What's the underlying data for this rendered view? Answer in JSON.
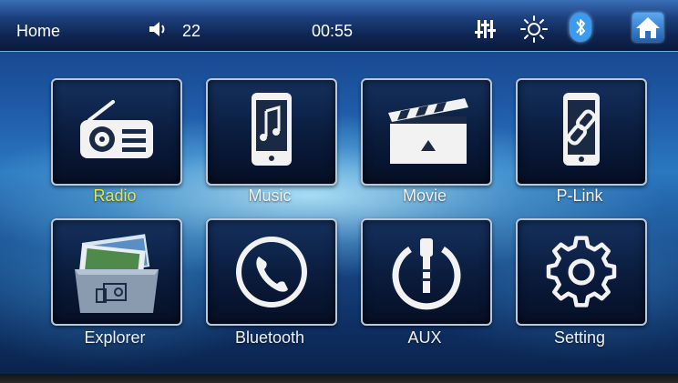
{
  "status_bar": {
    "home_label": "Home",
    "volume_value": "22",
    "clock": "00:55",
    "icons": [
      "speaker-icon",
      "equalizer-icon",
      "brightness-icon",
      "bluetooth-icon",
      "home-icon"
    ]
  },
  "apps": [
    {
      "label": "Radio",
      "icon": "radio-icon",
      "selected": true
    },
    {
      "label": "Music",
      "icon": "music-icon",
      "selected": false
    },
    {
      "label": "Movie",
      "icon": "movie-icon",
      "selected": false
    },
    {
      "label": "P-Link",
      "icon": "phone-link-icon",
      "selected": false
    },
    {
      "label": "Explorer",
      "icon": "explorer-icon",
      "selected": false
    },
    {
      "label": "Bluetooth",
      "icon": "phone-icon",
      "selected": false
    },
    {
      "label": "AUX",
      "icon": "aux-icon",
      "selected": false
    },
    {
      "label": "Setting",
      "icon": "gear-icon",
      "selected": false
    }
  ],
  "colors": {
    "selected_label": "#e8e63a",
    "label": "#f0f0f0",
    "accent": "#3b9bf0"
  }
}
